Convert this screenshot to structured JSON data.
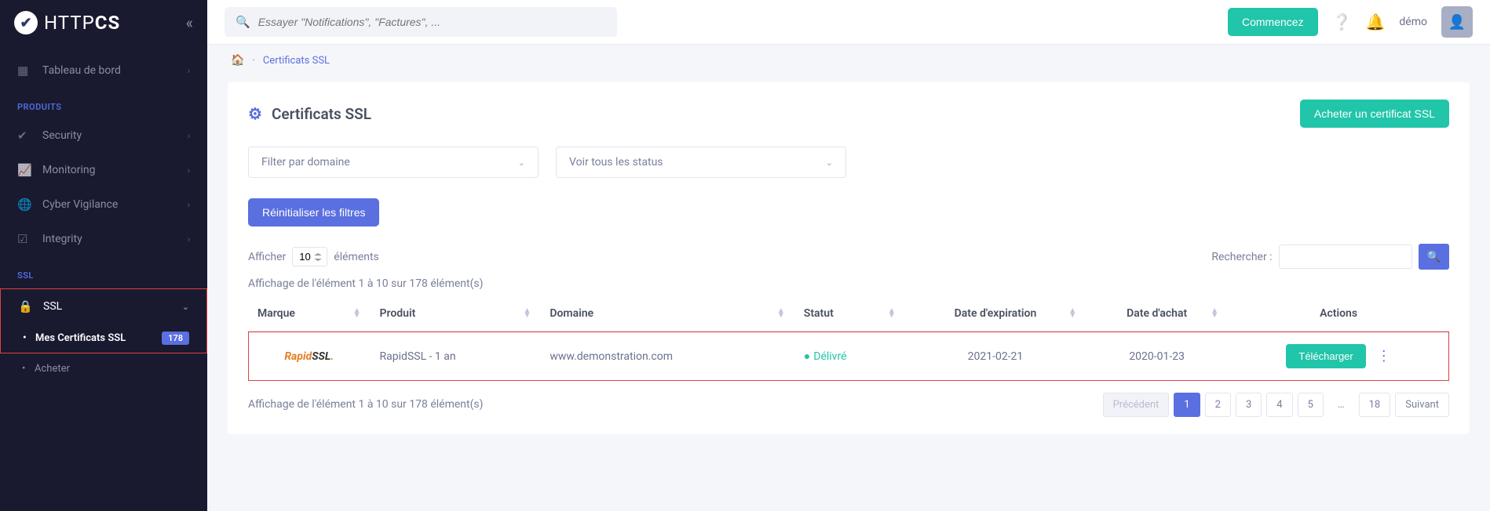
{
  "logo": {
    "prefix": "HTTP",
    "suffix": "CS"
  },
  "search": {
    "placeholder": "Essayer \"Notifications\", \"Factures\", ..."
  },
  "topbar": {
    "commence": "Commencez",
    "user": "démo"
  },
  "sidebar": {
    "dashboard": "Tableau de bord",
    "section_produits": "PRODUITS",
    "security": "Security",
    "monitoring": "Monitoring",
    "cyber": "Cyber Vigilance",
    "integrity": "Integrity",
    "section_ssl": "SSL",
    "ssl": "SSL",
    "mes_cert": "Mes Certificats SSL",
    "mes_cert_badge": "178",
    "acheter": "Acheter"
  },
  "crumbs": {
    "current": "Certificats SSL"
  },
  "panel": {
    "title": "Certificats SSL",
    "buy_btn": "Acheter un certificat SSL",
    "filter_domain": "Filter par domaine",
    "filter_status": "Voir tous les status",
    "reset": "Réinitialiser les filtres",
    "show_prefix": "Afficher",
    "show_suffix": "éléments",
    "show_value": "10",
    "search_label": "Rechercher :",
    "info": "Affichage de l'élément 1 à 10 sur 178 élément(s)"
  },
  "table": {
    "headers": {
      "brand": "Marque",
      "product": "Produit",
      "domain": "Domaine",
      "status": "Statut",
      "exp": "Date d'expiration",
      "purchase": "Date d'achat",
      "actions": "Actions"
    },
    "row": {
      "brand_r": "Rapid",
      "brand_s": "SSL",
      "brand_dot": ".",
      "product": "RapidSSL - 1 an",
      "domain": "www.demonstration.com",
      "status": "Délivré",
      "exp": "2021-02-21",
      "purchase": "2020-01-23",
      "download": "Télécharger"
    }
  },
  "pagination": {
    "prev": "Précédent",
    "p1": "1",
    "p2": "2",
    "p3": "3",
    "p4": "4",
    "p5": "5",
    "ellipsis": "…",
    "last": "18",
    "next": "Suivant"
  }
}
